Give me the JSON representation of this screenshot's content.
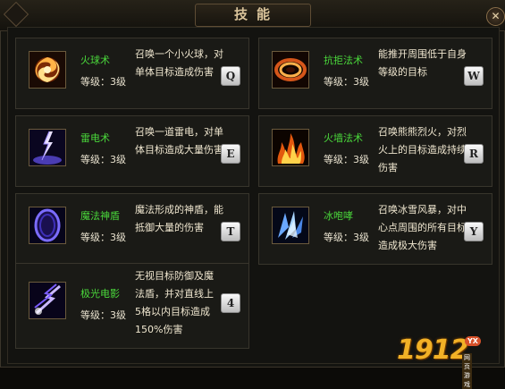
{
  "window": {
    "title": "技能",
    "close_icon": "close-icon"
  },
  "skills": [
    {
      "name": "火球术",
      "level": "等级：3",
      "level_suffix": "级",
      "desc": "召唤一个小火球，对单体目标造成伤害",
      "key": "Q",
      "icon": "fireball-icon"
    },
    {
      "name": "抗拒法术",
      "level": "等级：3",
      "level_suffix": "级",
      "desc": "能推开周围低于自身等级的目标",
      "key": "W",
      "icon": "repel-icon"
    },
    {
      "name": "雷电术",
      "level": "等级：3",
      "level_suffix": "级",
      "desc": "召唤一道雷电，对单体目标造成大量伤害",
      "key": "E",
      "icon": "lightning-icon"
    },
    {
      "name": "火墙法术",
      "level": "等级：3",
      "level_suffix": "级",
      "desc": "召唤熊熊烈火，对烈火上的目标造成持续伤害",
      "key": "R",
      "icon": "firewall-icon"
    },
    {
      "name": "魔法神盾",
      "level": "等级：3",
      "level_suffix": "级",
      "desc": "魔法形成的神盾，能抵御大量的伤害",
      "key": "T",
      "icon": "magic-shield-icon"
    },
    {
      "name": "冰咆哮",
      "level": "等级：3",
      "level_suffix": "级",
      "desc": "召唤冰雪风暴，对中心点周围的所有目标造成极大伤害",
      "key": "Y",
      "icon": "ice-roar-icon"
    },
    {
      "name": "极光电影",
      "level": "等级：3",
      "level_suffix": "级",
      "desc": "无视目标防御及魔法盾，并对直线上5格以内目标造成150%伤害",
      "key": "4",
      "icon": "aurora-lightning-icon"
    }
  ],
  "logo": {
    "number": "1912",
    "badge": "YX",
    "sub": "网页游戏"
  },
  "colors": {
    "skill_name": "#4ad83b",
    "text": "#efe6cf",
    "title": "#d9c39a",
    "logo": "#f2b126"
  }
}
